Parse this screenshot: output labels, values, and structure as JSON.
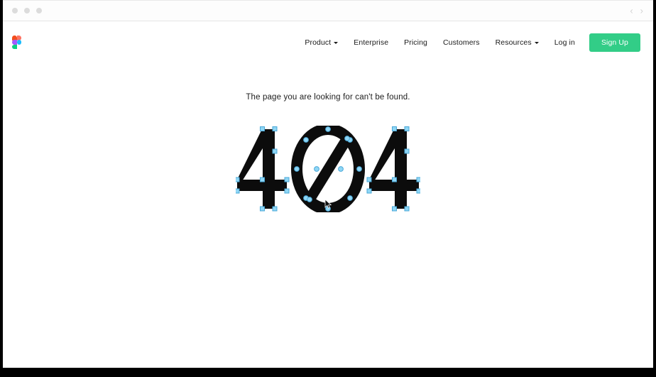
{
  "window": {
    "traffic_lights": [
      "close",
      "minimize",
      "maximize"
    ],
    "nav_back_icon": "chevron-left-icon",
    "nav_forward_icon": "chevron-right-icon",
    "back_glyph": "‹",
    "forward_glyph": "›"
  },
  "header": {
    "logo_name": "figma-logo",
    "nav": [
      {
        "label": "Product",
        "has_caret": true
      },
      {
        "label": "Enterprise",
        "has_caret": false
      },
      {
        "label": "Pricing",
        "has_caret": false
      },
      {
        "label": "Customers",
        "has_caret": false
      },
      {
        "label": "Resources",
        "has_caret": true
      },
      {
        "label": "Log in",
        "has_caret": false
      }
    ],
    "signup_label": "Sign Up"
  },
  "main": {
    "message": "The page you are looking for can't be found.",
    "error_code": "404",
    "artwork_description": "404 rendered as an editable vector outline with selection anchor points, zero drawn as a slashed zero"
  },
  "colors": {
    "accent_green": "#32cd87",
    "vector_node": "#8fd6f5",
    "vector_node_stroke": "#4aa8d8",
    "glyph_black": "#0c0c0c",
    "page_background": "#ffffff",
    "frame_black": "#000000",
    "traffic_dot": "#dcdcdc",
    "nav_arrow": "#d2d2d2",
    "logo_orange": "#f24e1e",
    "logo_red": "#ff7262",
    "logo_purple": "#a259ff",
    "logo_blue": "#1abcfe",
    "logo_green": "#0acf83"
  }
}
